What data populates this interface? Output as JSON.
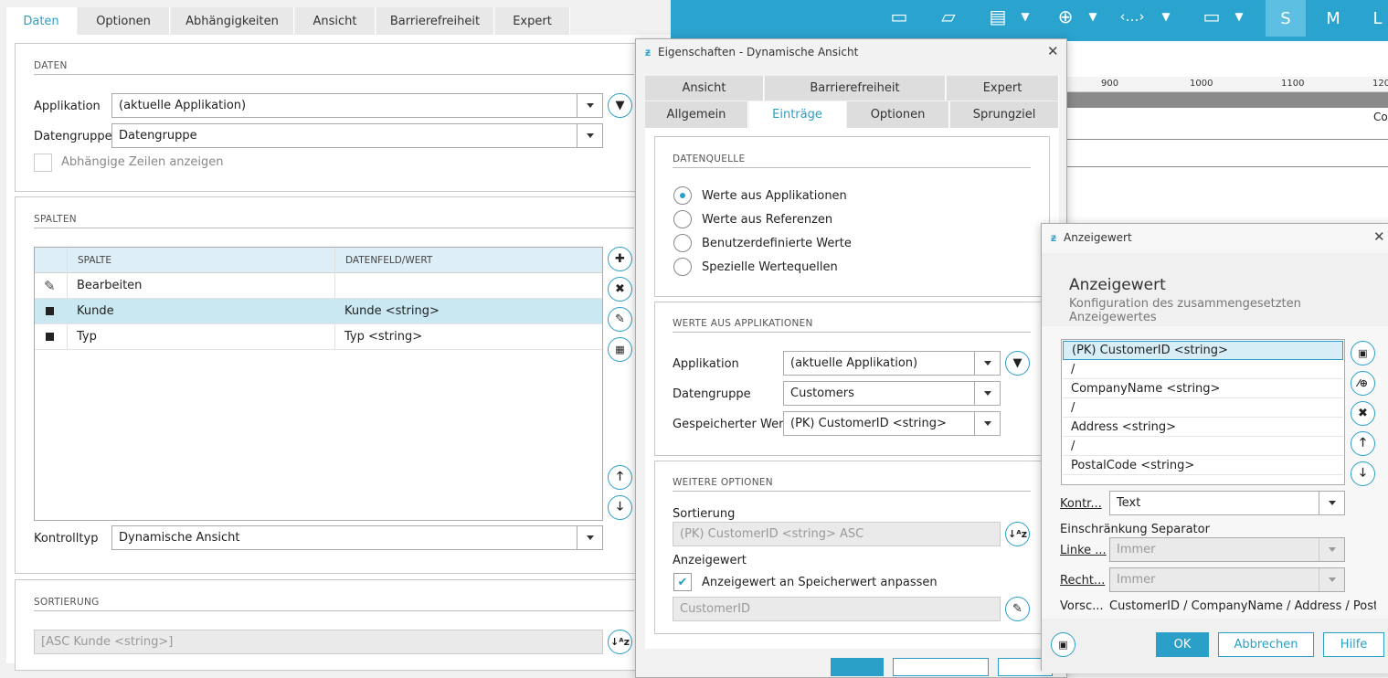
{
  "main_tabs": [
    "Daten",
    "Optionen",
    "Abhängigkeiten",
    "Ansicht",
    "Barrierefreiheit",
    "Expert"
  ],
  "daten": {
    "section": "DATEN",
    "applikation_label": "Applikation",
    "applikation_value": "(aktuelle Applikation)",
    "datengruppe_label": "Datengruppe",
    "datengruppe_value": "Datengruppe",
    "abh_zeilen": "Abhängige Zeilen anzeigen"
  },
  "spalten": {
    "section": "SPALTEN",
    "col1": "SPALTE",
    "col2": "DATENFELD/WERT",
    "rows": [
      {
        "name": "Bearbeiten",
        "value": ""
      },
      {
        "name": "Kunde",
        "value": "Kunde <string>"
      },
      {
        "name": "Typ",
        "value": "Typ <string>"
      }
    ],
    "kontrolltyp_label": "Kontrolltyp",
    "kontrolltyp_value": "Dynamische Ansicht"
  },
  "sortierung": {
    "section": "SORTIERUNG",
    "value": "[ASC Kunde <string>]"
  },
  "ruler": {
    "t900": "900",
    "t1000": "1000",
    "t1100": "1100",
    "t1200": "120",
    "co": "Co"
  },
  "toolbar": {
    "s": "S",
    "m": "M",
    "l": "L"
  },
  "props": {
    "title": "Eigenschaften - Dynamische Ansicht",
    "tabs_top": [
      "Ansicht",
      "Barrierefreiheit",
      "Expert"
    ],
    "tabs_bottom": [
      "Allgemein",
      "Einträge",
      "Optionen",
      "Sprungziel"
    ],
    "datenquelle": "DATENQUELLE",
    "radios": [
      "Werte aus Applikationen",
      "Werte aus Referenzen",
      "Benutzerdefinierte Werte",
      "Spezielle Wertequellen"
    ],
    "werte": "WERTE AUS APPLIKATIONEN",
    "app_label": "Applikation",
    "app_value": "(aktuelle Applikation)",
    "dg_label": "Datengruppe",
    "dg_value": "Customers",
    "gw_label": "Gespeicherter Wert",
    "gw_value": "(PK) CustomerID <string>",
    "weitere": "WEITERE OPTIONEN",
    "sort_label": "Sortierung",
    "sort_value": "(PK) CustomerID <string> ASC",
    "anz_label": "Anzeigewert",
    "anz_chk": "Anzeigewert an Speicherwert anpassen",
    "anz_value": "CustomerID"
  },
  "anz": {
    "title": "Anzeigewert",
    "heading": "Anzeigewert",
    "sub": "Konfiguration des zusammengesetzten Anzeigewertes",
    "items": [
      "(PK) CustomerID <string>",
      "/",
      "CompanyName <string>",
      "/",
      "Address <string>",
      "/",
      "PostalCode <string>"
    ],
    "kontr_label": "Kontr...",
    "kontr_value": "Text",
    "einschr": "Einschränkung Separator",
    "linke_label": "Linke ...",
    "linke_value": "Immer",
    "rechte_label": "Recht...",
    "rechte_value": "Immer",
    "vorsc_label": "Vorsc...",
    "vorsc_value": "CustomerID / CompanyName / Address / Posta...",
    "ok": "OK",
    "abbrechen": "Abbrechen",
    "hilfe": "Hilfe"
  }
}
